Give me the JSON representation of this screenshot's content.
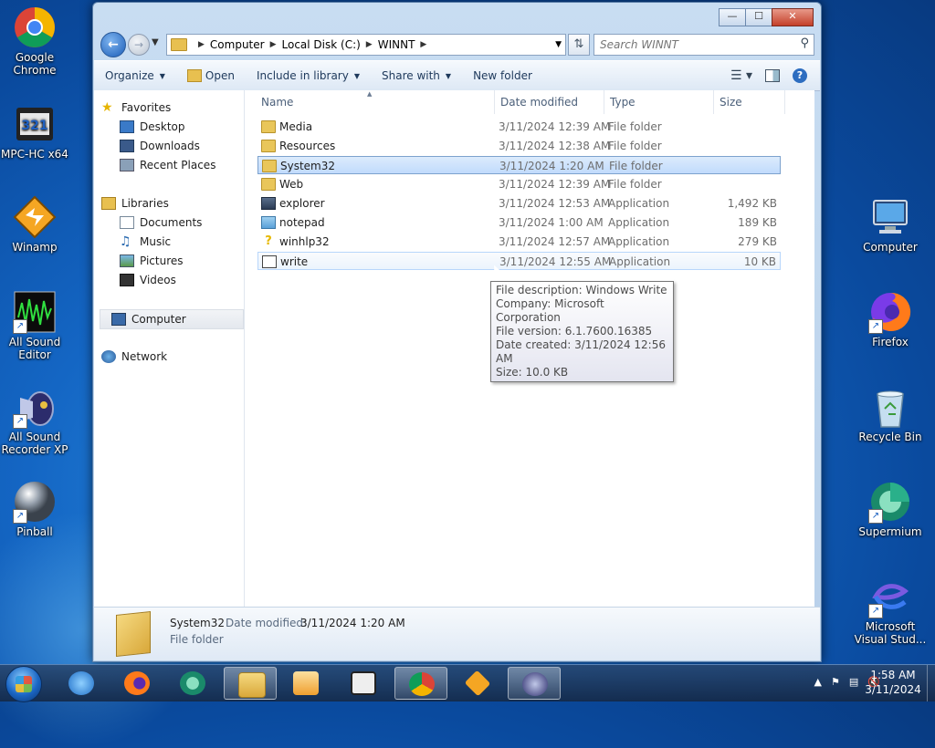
{
  "desktop": {
    "left_icons": [
      {
        "label": "Google Chrome",
        "icon": "chrome-icon"
      },
      {
        "label": "MPC-HC x64",
        "icon": "mpc-hc-icon"
      },
      {
        "label": "Winamp",
        "icon": "winamp-icon"
      },
      {
        "label": "All Sound Editor",
        "icon": "sound-editor-icon"
      },
      {
        "label": "All Sound Recorder XP",
        "icon": "sound-recorder-icon"
      },
      {
        "label": "Pinball",
        "icon": "pinball-icon"
      }
    ],
    "right_icons": [
      {
        "label": "Computer",
        "icon": "computer-icon"
      },
      {
        "label": "Firefox",
        "icon": "firefox-icon"
      },
      {
        "label": "Recycle Bin",
        "icon": "recycle-bin-icon"
      },
      {
        "label": "Supermium",
        "icon": "supermium-icon"
      },
      {
        "label": "Microsoft Visual Stud...",
        "icon": "visual-studio-icon"
      }
    ]
  },
  "explorer": {
    "caption": {
      "minimize": "—",
      "maximize": "☐",
      "close": "✕"
    },
    "address": {
      "crumbs": [
        "Computer",
        "Local Disk (C:)",
        "WINNT"
      ]
    },
    "search": {
      "placeholder": "Search WINNT"
    },
    "toolbar": {
      "organize": "Organize",
      "open": "Open",
      "include": "Include in library",
      "share": "Share with",
      "new_folder": "New folder"
    },
    "nav": {
      "favorites": "Favorites",
      "desktop": "Desktop",
      "downloads": "Downloads",
      "recent": "Recent Places",
      "libraries": "Libraries",
      "documents": "Documents",
      "music": "Music",
      "pictures": "Pictures",
      "videos": "Videos",
      "computer": "Computer",
      "network": "Network"
    },
    "columns": {
      "name": "Name",
      "date": "Date modified",
      "type": "Type",
      "size": "Size"
    },
    "files": [
      {
        "name": "Media",
        "date": "3/11/2024 12:39 AM",
        "type": "File folder",
        "size": "",
        "icon": "folder-icon"
      },
      {
        "name": "Resources",
        "date": "3/11/2024 12:38 AM",
        "type": "File folder",
        "size": "",
        "icon": "folder-icon"
      },
      {
        "name": "System32",
        "date": "3/11/2024 1:20 AM",
        "type": "File folder",
        "size": "",
        "icon": "folder-icon"
      },
      {
        "name": "Web",
        "date": "3/11/2024 12:39 AM",
        "type": "File folder",
        "size": "",
        "icon": "folder-icon"
      },
      {
        "name": "explorer",
        "date": "3/11/2024 12:53 AM",
        "type": "Application",
        "size": "1,492 KB",
        "icon": "explorer-app-icon"
      },
      {
        "name": "notepad",
        "date": "3/11/2024 1:00 AM",
        "type": "Application",
        "size": "189 KB",
        "icon": "notepad-icon"
      },
      {
        "name": "winhlp32",
        "date": "3/11/2024 12:57 AM",
        "type": "Application",
        "size": "279 KB",
        "icon": "help-icon"
      },
      {
        "name": "write",
        "date": "3/11/2024 12:55 AM",
        "type": "Application",
        "size": "10 KB",
        "icon": "write-icon"
      }
    ],
    "tooltip": {
      "l1": "File description: Windows Write",
      "l2": "Company: Microsoft Corporation",
      "l3": "File version: 6.1.7600.16385",
      "l4": "Date created: 3/11/2024 12:56 AM",
      "l5": "Size: 10.0 KB"
    },
    "details": {
      "name": "System32",
      "date_label": "Date modified:",
      "date_value": "3/11/2024 1:20 AM",
      "type": "File folder"
    }
  },
  "taskbar": {
    "clock_time": "1:58 AM",
    "clock_date": "3/11/2024"
  }
}
